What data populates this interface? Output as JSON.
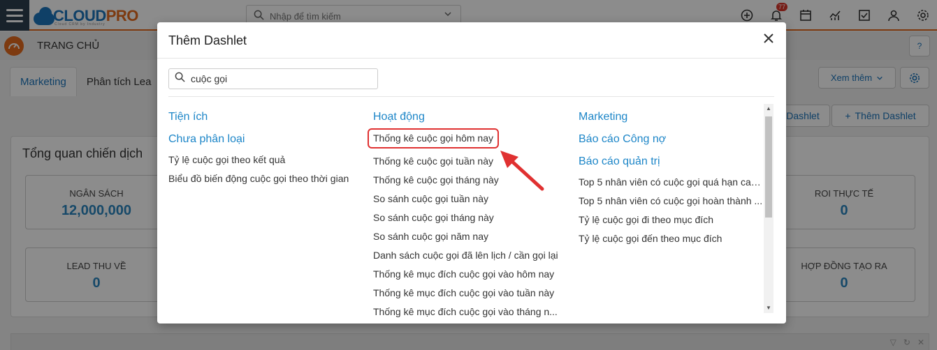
{
  "topbar": {
    "logo_main": "CLOUD",
    "logo_accent": "PRO",
    "logo_sub": "Cloud CRM by Industry",
    "search_placeholder": "Nhập để tìm kiếm",
    "notification_count": "77"
  },
  "breadcrumb": {
    "title": "TRANG CHỦ"
  },
  "tabs": [
    {
      "label": "Marketing"
    },
    {
      "label": "Phân tích Lea"
    }
  ],
  "toolbar": {
    "more_label": "Xem thêm",
    "dashlet_label": "Dashlet",
    "add_dashlet_label": "Thêm Dashlet"
  },
  "panel": {
    "title": "Tổng quan chiến dịch",
    "stats": [
      {
        "label": "NGÂN SÁCH",
        "value": "12,000,000"
      },
      {
        "label": "ROI THỰC TẾ",
        "value": "0"
      },
      {
        "label": "LEAD THU VỀ",
        "value": "0"
      },
      {
        "label": "HỢP ĐỒNG TẠO RA",
        "value": "0"
      }
    ]
  },
  "modal": {
    "title": "Thêm Dashlet",
    "search_value": "cuộc gọi",
    "columns": [
      {
        "groups": [
          {
            "category": "Tiện ích",
            "items": []
          },
          {
            "category": "Chưa phân loại",
            "items": [
              "Tỷ lệ cuộc gọi theo kết quả",
              "Biểu đồ biến động cuộc gọi theo thời gian"
            ]
          }
        ]
      },
      {
        "groups": [
          {
            "category": "Hoạt động",
            "items": [
              "Thống kê cuộc gọi hôm nay",
              "Thống kê cuộc gọi tuần này",
              "Thống kê cuộc gọi tháng này",
              "So sánh cuộc gọi tuần này",
              "So sánh cuộc gọi tháng này",
              "So sánh cuộc gọi năm nay",
              "Danh sách cuộc gọi đã lên lịch / cần gọi lại",
              "Thống kê mục đích cuộc gọi vào hôm nay",
              "Thống kê mục đích cuộc gọi vào tuần này",
              "Thống kê mục đích cuộc gọi vào tháng n..."
            ]
          }
        ]
      },
      {
        "groups": [
          {
            "category": "Marketing",
            "items": []
          },
          {
            "category": "Báo cáo Công nợ",
            "items": []
          },
          {
            "category": "Báo cáo quản trị",
            "items": [
              "Top 5 nhân viên có cuộc gọi quá hạn cao...",
              "Top 5 nhân viên có cuộc gọi hoàn thành ...",
              "Tỷ lệ cuộc gọi đi theo mục đích",
              "Tỷ lệ cuộc gọi đến theo mục đích"
            ]
          }
        ]
      }
    ]
  },
  "colors": {
    "brand_blue": "#1d76bc",
    "brand_orange": "#e36a1e",
    "category_blue": "#1d86c8",
    "highlight_red": "#e03131"
  }
}
